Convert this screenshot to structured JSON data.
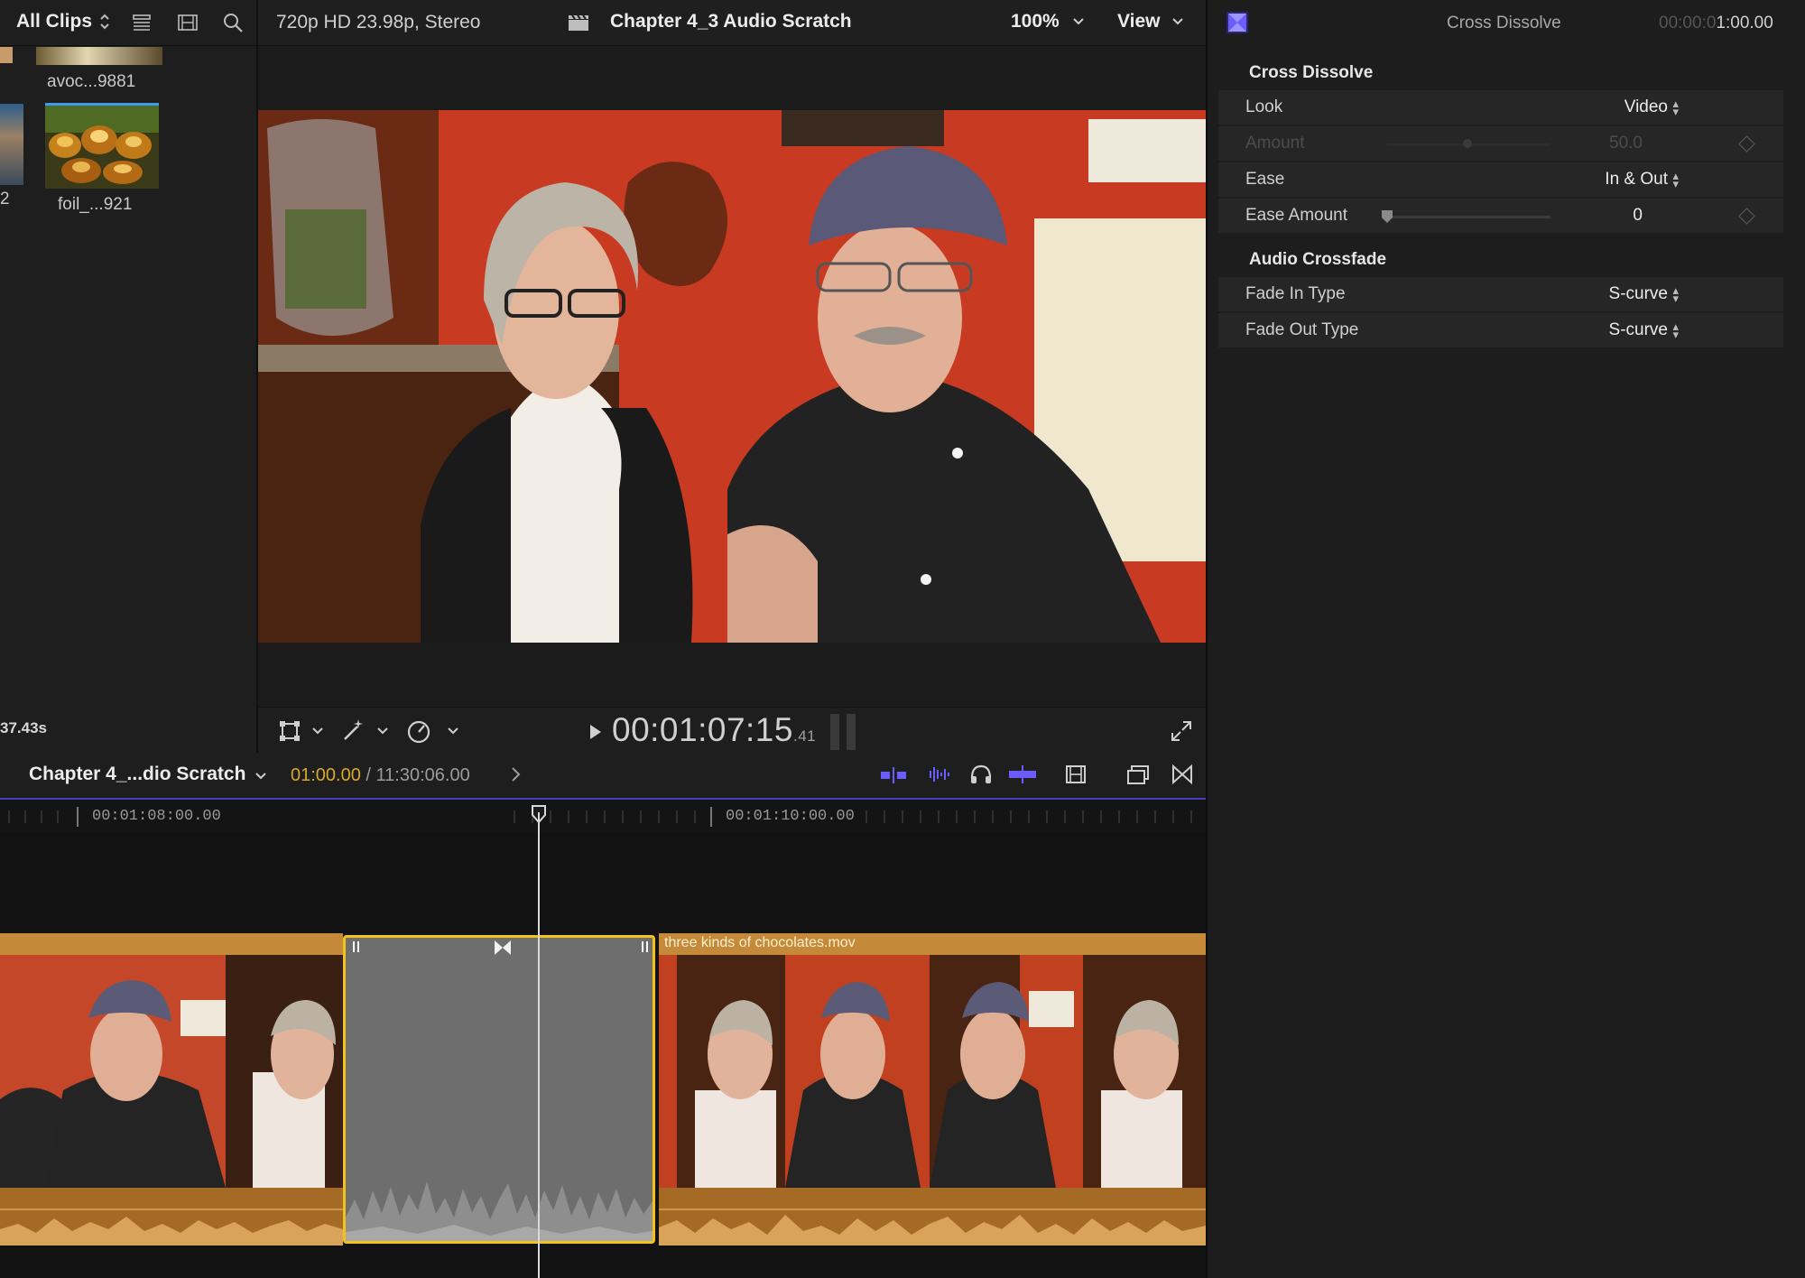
{
  "browser": {
    "filter_label": "All Clips",
    "icons": [
      "list-view-icon",
      "filmstrip-view-icon",
      "search-icon"
    ],
    "clips": [
      {
        "name": "avoc...9881"
      },
      {
        "name": "foil_...921"
      }
    ],
    "edge_label": "2",
    "duration": "37.43s"
  },
  "viewer": {
    "format": "720p HD 23.98p, Stereo",
    "project_title": "Chapter 4_3 Audio Scratch",
    "zoom": "100%",
    "view_label": "View",
    "timecode_main": "00:01:07:15",
    "timecode_sub": ".41"
  },
  "inspector": {
    "title": "Cross Dissolve",
    "time_dim": "00:00:0",
    "time_bright": "1:00.00",
    "sections": [
      {
        "title": "Cross Dissolve",
        "rows": [
          {
            "label": "Look",
            "value": "Video"
          },
          {
            "label": "Amount",
            "value": "50.0",
            "disabled": true
          },
          {
            "label": "Ease",
            "value": "In & Out"
          },
          {
            "label": "Ease Amount",
            "value": "0"
          }
        ]
      },
      {
        "title": "Audio Crossfade",
        "rows": [
          {
            "label": "Fade In Type",
            "value": "S-curve"
          },
          {
            "label": "Fade Out Type",
            "value": "S-curve"
          }
        ]
      }
    ]
  },
  "timeline": {
    "project_name": "Chapter 4_...dio Scratch",
    "current_time": "01:00.00",
    "total_time": "/ 11:30:06.00",
    "ruler_labels": [
      "00:01:08:00.00",
      "00:01:10:00.00"
    ],
    "clip_name": "three kinds of chocolates.mov"
  },
  "colors": {
    "accent": "#5a4fe0",
    "clip_orange": "#c58a39",
    "selection_yellow": "#f1c21b",
    "timecode_yellow": "#d7a92a"
  }
}
